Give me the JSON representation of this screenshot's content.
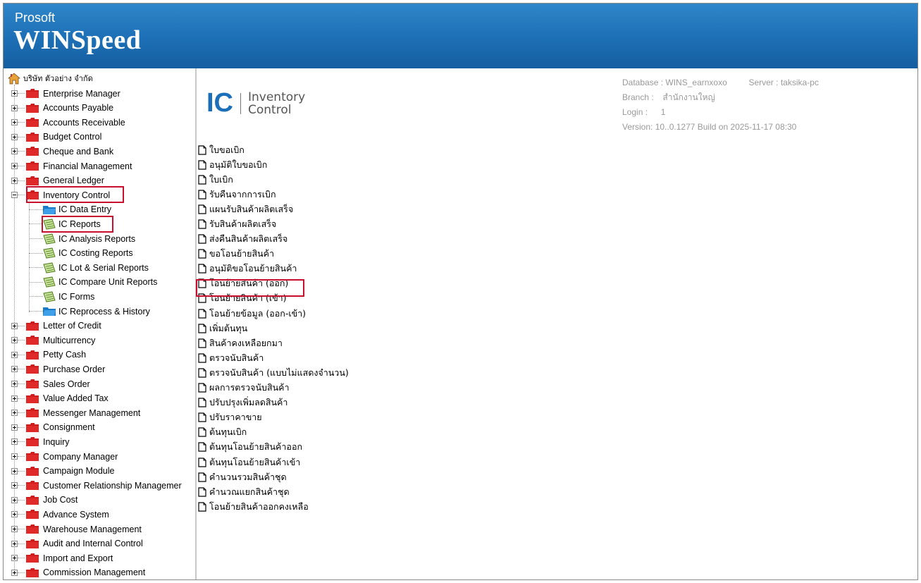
{
  "header": {
    "brand_small": "Prosoft",
    "brand_big": "WINSpeed"
  },
  "tree": {
    "root_label": "บริษัท ตัวอย่าง จำกัด",
    "top_items": [
      {
        "label": "Enterprise Manager"
      },
      {
        "label": "Accounts Payable"
      },
      {
        "label": "Accounts Receivable"
      },
      {
        "label": "Budget Control"
      },
      {
        "label": "Cheque and Bank"
      },
      {
        "label": "Financial Management"
      },
      {
        "label": "General Ledger"
      },
      {
        "label": "Inventory Control"
      }
    ],
    "ic_children": [
      {
        "label": "IC Data Entry",
        "icon": "folder-blue-icon"
      },
      {
        "label": "IC Reports",
        "icon": "report-icon"
      },
      {
        "label": "IC Analysis Reports",
        "icon": "report-icon"
      },
      {
        "label": "IC Costing Reports",
        "icon": "report-icon"
      },
      {
        "label": "IC Lot & Serial Reports",
        "icon": "report-icon"
      },
      {
        "label": "IC Compare Unit Reports",
        "icon": "report-icon"
      },
      {
        "label": "IC Forms",
        "icon": "report-icon"
      },
      {
        "label": "IC Reprocess & History",
        "icon": "folder-blue-icon"
      }
    ],
    "bottom_items": [
      {
        "label": "Letter of Credit"
      },
      {
        "label": "Multicurrency"
      },
      {
        "label": "Petty Cash"
      },
      {
        "label": "Purchase Order"
      },
      {
        "label": "Sales Order"
      },
      {
        "label": "Value Added Tax"
      },
      {
        "label": "Messenger Management"
      },
      {
        "label": "Consignment"
      },
      {
        "label": "Inquiry"
      },
      {
        "label": "Company Manager"
      },
      {
        "label": "Campaign Module"
      },
      {
        "label": "Customer Relationship Managemer"
      },
      {
        "label": "Job Cost"
      },
      {
        "label": "Advance System"
      },
      {
        "label": "Warehouse Management"
      },
      {
        "label": "Audit and Internal Control"
      },
      {
        "label": "Import and Export"
      },
      {
        "label": "Commission Management"
      }
    ]
  },
  "module": {
    "code": "IC",
    "name_line1": "Inventory",
    "name_line2": "Control"
  },
  "info": {
    "database_label": "Database :",
    "database_value": "WINS_earnxoxo",
    "server_label": "Server :",
    "server_value": "taksika-pc",
    "branch_label": "Branch :",
    "branch_value": "สำนักงานใหญ่",
    "login_label": "Login :",
    "login_value": "1",
    "version": "Version: 10..0.1277  Build on 2025-11-17  08:30"
  },
  "documents": [
    {
      "label": "ใบขอเบิก"
    },
    {
      "label": "อนุมัติใบขอเบิก"
    },
    {
      "label": "ใบเบิก"
    },
    {
      "label": "รับคืนจากการเบิก"
    },
    {
      "label": "แผนรับสินค้าผลิตเสร็จ"
    },
    {
      "label": "รับสินค้าผลิตเสร็จ"
    },
    {
      "label": "ส่งคืนสินค้าผลิตเสร็จ"
    },
    {
      "label": "ขอโอนย้ายสินค้า"
    },
    {
      "label": "อนุมัติขอโอนย้ายสินค้า"
    },
    {
      "label": "โอนย้ายสินค้า (ออก)"
    },
    {
      "label": "โอนย้ายสินค้า (เข้า)"
    },
    {
      "label": "โอนย้ายข้อมูล (ออก-เข้า)"
    },
    {
      "label": "เพิ่มต้นทุน"
    },
    {
      "label": "สินค้าคงเหลือยกมา"
    },
    {
      "label": "ตรวจนับสินค้า"
    },
    {
      "label": "ตรวจนับสินค้า (แบบไม่แสดงจำนวน)"
    },
    {
      "label": "ผลการตรวจนับสินค้า"
    },
    {
      "label": "ปรับปรุงเพิ่มลดสินค้า"
    },
    {
      "label": "ปรับราคาขาย"
    },
    {
      "label": "ต้นทุนเบิก"
    },
    {
      "label": "ต้นทุนโอนย้ายสินค้าออก"
    },
    {
      "label": "ต้นทุนโอนย้ายสินค้าเข้า"
    },
    {
      "label": "คำนวนรวมสินค้าชุด"
    },
    {
      "label": "คำนวณแยกสินค้าชุด"
    },
    {
      "label": "โอนย้ายสินค้าออกคงเหลือ"
    }
  ],
  "colors": {
    "header_blue": "#1d6fb5",
    "highlight_red": "#c8102e",
    "folder_red": "#d01c1c",
    "ic_blue": "#1a6fb8"
  }
}
